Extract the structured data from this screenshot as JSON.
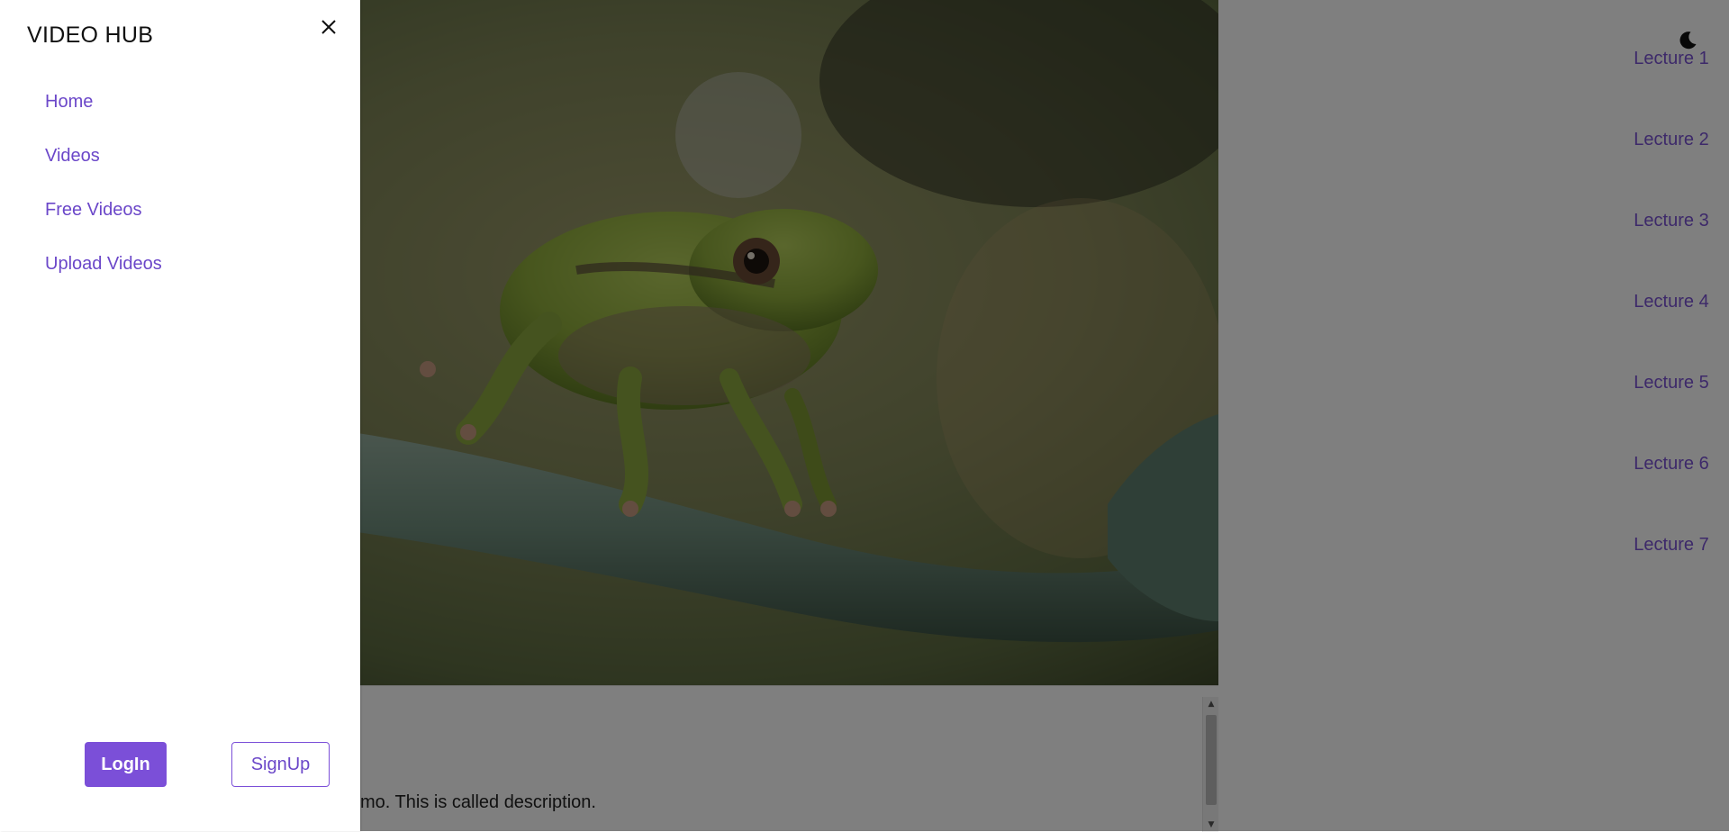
{
  "drawer": {
    "title": "VIDEO HUB",
    "nav": [
      {
        "label": "Home"
      },
      {
        "label": "Videos"
      },
      {
        "label": "Free Videos"
      },
      {
        "label": "Upload Videos"
      }
    ],
    "login_label": "LogIn",
    "signup_label": "SignUp",
    "close_icon": "close-icon"
  },
  "lectures": [
    {
      "label": "Lecture 1"
    },
    {
      "label": "Lecture 2"
    },
    {
      "label": "Lecture 3"
    },
    {
      "label": "Lecture 4"
    },
    {
      "label": "Lecture 5"
    },
    {
      "label": "Lecture 6"
    },
    {
      "label": "Lecture 7"
    }
  ],
  "description": {
    "visible_text": "mo. This is called description."
  },
  "theme_toggle_icon": "moon-icon",
  "colors": {
    "accent": "#7b4fd8",
    "link": "#6b47c9",
    "backdrop": "rgba(0,0,0,0.5)"
  }
}
